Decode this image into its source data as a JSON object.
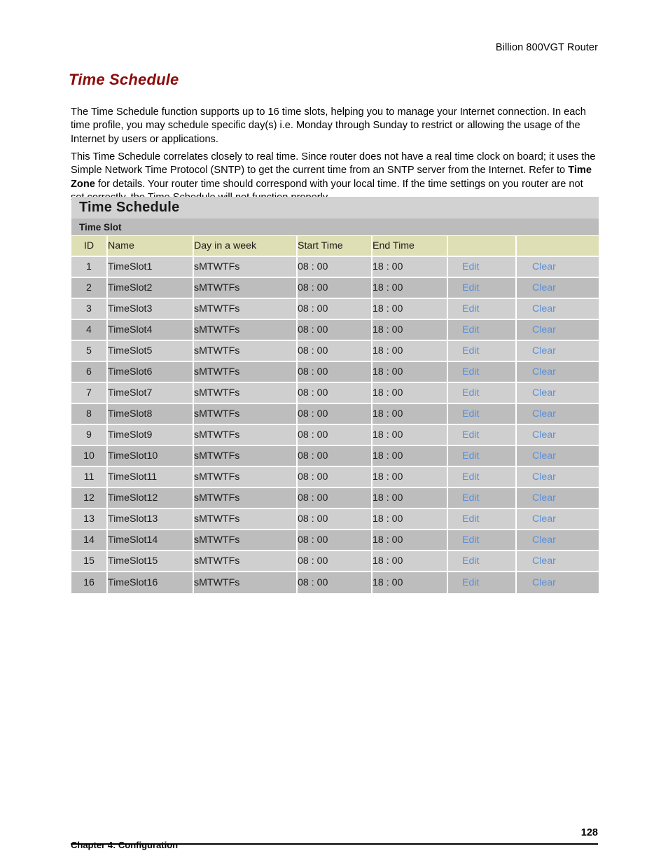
{
  "running_head": "Billion 800VGT Router",
  "section": {
    "heading": "Time Schedule",
    "paragraphs": {
      "p1": "The Time Schedule function supports up to 16 time slots, helping you to manage your Internet connection. In each time profile, you may schedule specific day(s) i.e. Monday through Sunday to restrict or allowing the usage of the Internet by users or applications.",
      "p2_part1": "This Time Schedule correlates closely to real time.  Since router does not have a real time clock on board; it uses the Simple Network Time Protocol (SNTP) to get the current time from an SNTP server from the Internet. Refer to ",
      "p2_bold": "Time Zone",
      "p2_part2": " for details. Your router time should correspond with your local time. If the time settings on you router are not set correctly, the Time Schedule will not function properly."
    }
  },
  "panel": {
    "title": "Time Schedule",
    "subtitle": "Time Slot",
    "colors": {
      "panel_title_bg": "#d2d2d2",
      "panel_subtitle_bg": "#bcbcbc",
      "header_row_bg": "#dedfb4",
      "row_odd_bg": "#cfcfcf",
      "row_even_bg": "#bdbdbd",
      "link_color": "#5a8fd8",
      "heading_color": "#8c0a0a"
    },
    "columns": [
      "ID",
      "Name",
      "Day in a week",
      "Start Time",
      "End Time",
      "",
      ""
    ],
    "actions": {
      "edit": "Edit",
      "clear": "Clear"
    },
    "rows": [
      {
        "id": "1",
        "name": "TimeSlot1",
        "day": "sMTWTFs",
        "start": "08 : 00",
        "end": "18 : 00",
        "edit": "Edit",
        "clear": "Clear"
      },
      {
        "id": "2",
        "name": "TimeSlot2",
        "day": "sMTWTFs",
        "start": "08 : 00",
        "end": "18 : 00",
        "edit": "Edit",
        "clear": "Clear"
      },
      {
        "id": "3",
        "name": "TimeSlot3",
        "day": "sMTWTFs",
        "start": "08 : 00",
        "end": "18 : 00",
        "edit": "Edit",
        "clear": "Clear"
      },
      {
        "id": "4",
        "name": "TimeSlot4",
        "day": "sMTWTFs",
        "start": "08 : 00",
        "end": "18 : 00",
        "edit": "Edit",
        "clear": "Clear"
      },
      {
        "id": "5",
        "name": "TimeSlot5",
        "day": "sMTWTFs",
        "start": "08 : 00",
        "end": "18 : 00",
        "edit": "Edit",
        "clear": "Clear"
      },
      {
        "id": "6",
        "name": "TimeSlot6",
        "day": "sMTWTFs",
        "start": "08 : 00",
        "end": "18 : 00",
        "edit": "Edit",
        "clear": "Clear"
      },
      {
        "id": "7",
        "name": "TimeSlot7",
        "day": "sMTWTFs",
        "start": "08 : 00",
        "end": "18 : 00",
        "edit": "Edit",
        "clear": "Clear"
      },
      {
        "id": "8",
        "name": "TimeSlot8",
        "day": "sMTWTFs",
        "start": "08 : 00",
        "end": "18 : 00",
        "edit": "Edit",
        "clear": "Clear"
      },
      {
        "id": "9",
        "name": "TimeSlot9",
        "day": "sMTWTFs",
        "start": "08 : 00",
        "end": "18 : 00",
        "edit": "Edit",
        "clear": "Clear"
      },
      {
        "id": "10",
        "name": "TimeSlot10",
        "day": "sMTWTFs",
        "start": "08 : 00",
        "end": "18 : 00",
        "edit": "Edit",
        "clear": "Clear"
      },
      {
        "id": "11",
        "name": "TimeSlot11",
        "day": "sMTWTFs",
        "start": "08 : 00",
        "end": "18 : 00",
        "edit": "Edit",
        "clear": "Clear"
      },
      {
        "id": "12",
        "name": "TimeSlot12",
        "day": "sMTWTFs",
        "start": "08 : 00",
        "end": "18 : 00",
        "edit": "Edit",
        "clear": "Clear"
      },
      {
        "id": "13",
        "name": "TimeSlot13",
        "day": "sMTWTFs",
        "start": "08 : 00",
        "end": "18 : 00",
        "edit": "Edit",
        "clear": "Clear"
      },
      {
        "id": "14",
        "name": "TimeSlot14",
        "day": "sMTWTFs",
        "start": "08 : 00",
        "end": "18 : 00",
        "edit": "Edit",
        "clear": "Clear"
      },
      {
        "id": "15",
        "name": "TimeSlot15",
        "day": "sMTWTFs",
        "start": "08 : 00",
        "end": "18 : 00",
        "edit": "Edit",
        "clear": "Clear"
      },
      {
        "id": "16",
        "name": "TimeSlot16",
        "day": "sMTWTFs",
        "start": "08 : 00",
        "end": "18 : 00",
        "edit": "Edit",
        "clear": "Clear"
      }
    ]
  },
  "footer": {
    "chapter": "Chapter 4: Configuration",
    "page_number": "128"
  }
}
